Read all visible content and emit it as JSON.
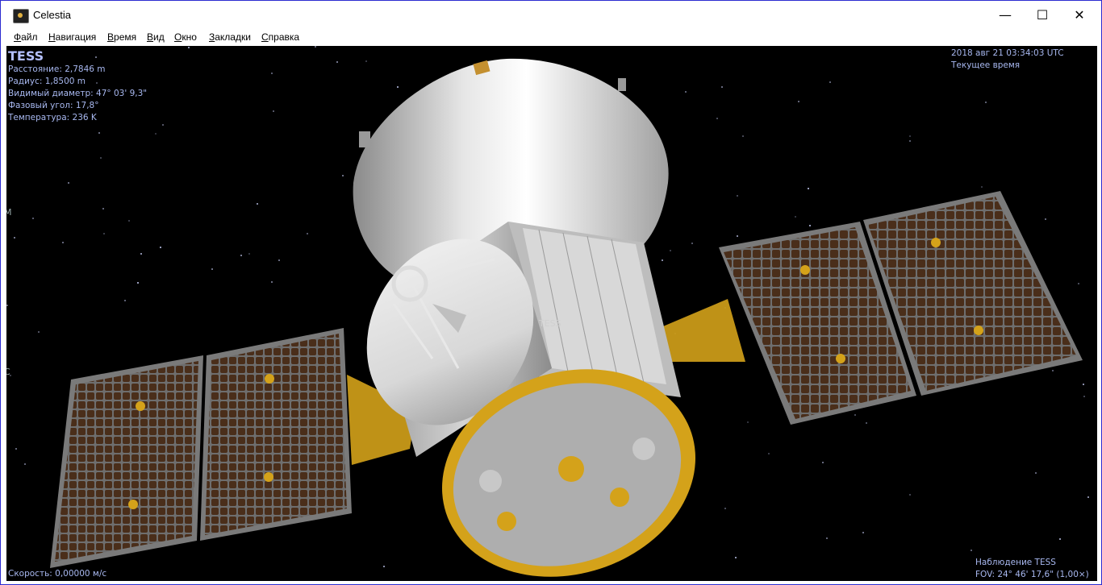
{
  "window": {
    "title": "Celestia",
    "minimize_glyph": "—",
    "maximize_glyph": "☐",
    "close_glyph": "✕"
  },
  "menubar": {
    "items": [
      "Файл",
      "Навигация",
      "Время",
      "Вид",
      "Окно",
      "Закладки",
      "Справка"
    ]
  },
  "object_info": {
    "name": "TESS",
    "distance": "Расстояние: 2,7846 m",
    "radius": "Радиус: 1,8500 m",
    "apparent_diameter": "Видимый диаметр: 47° 03' 9,3\"",
    "phase_angle": "Фазовый угол: 17,8°",
    "temperature": "Температура: 236 K"
  },
  "time_info": {
    "datetime": "2018 авг 21 03:34:03 UTC",
    "mode": "Текущее время"
  },
  "speed": "Скорость: 0,00000 м/с",
  "observe": {
    "target": "Наблюдение TESS",
    "fov": "FOV: 24° 46' 17,6\" (1,00×)"
  },
  "scene": {
    "object_label": "TESS",
    "edge_glyphs": [
      "M",
      "C"
    ]
  },
  "colors": {
    "hud_text": "#a8b8f0",
    "panel_cell": "#4a2e1a",
    "gold": "#d4a21a",
    "silver": "#c8c8c8"
  }
}
